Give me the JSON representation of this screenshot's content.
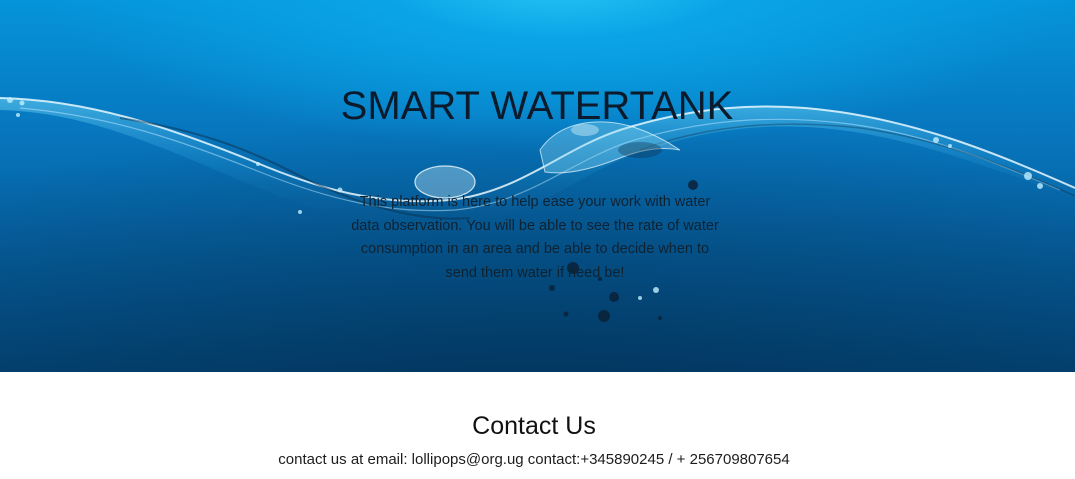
{
  "hero": {
    "title": "SMART WATERTANK",
    "description": "This platform is here to help ease your work with water data observation. You will be able to see the rate of water consumption in an area and be able to decide when to send them water if need be!"
  },
  "contact": {
    "title": "Contact Us",
    "line": "contact us at email: lollipops@org.ug contact:+345890245 / + 256709807654"
  },
  "colors": {
    "hero_top": "#0594d9",
    "hero_bottom": "#034475",
    "text_dark": "#0b1b2c"
  }
}
